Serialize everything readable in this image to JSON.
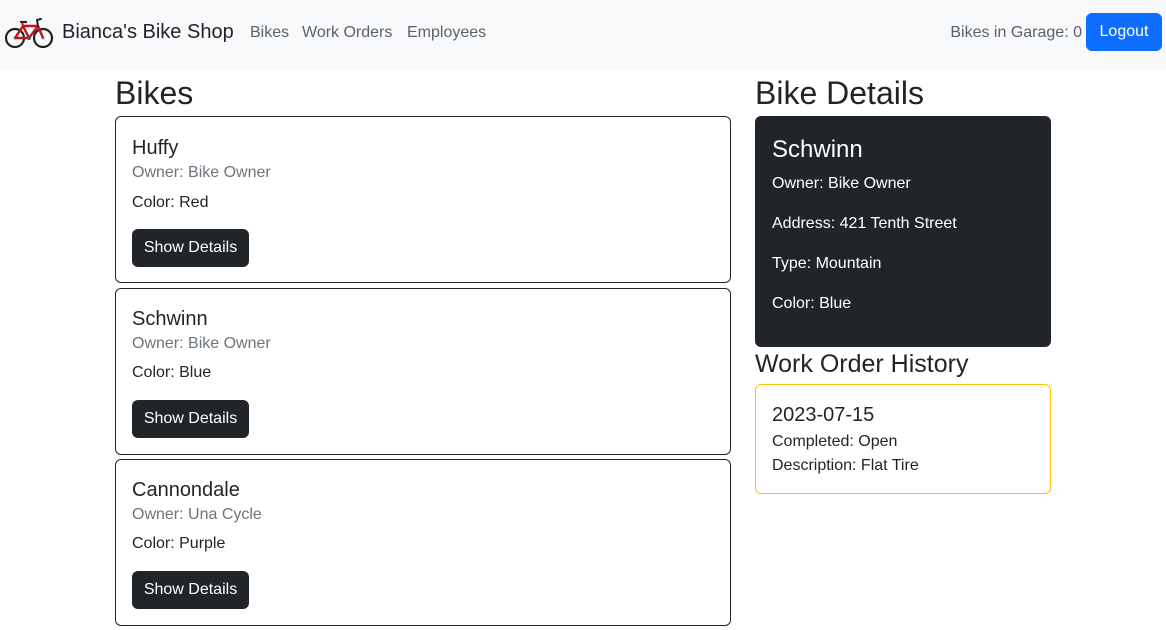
{
  "navbar": {
    "brand": "Bianca's Bike Shop",
    "links": [
      "Bikes",
      "Work Orders",
      "Employees"
    ],
    "garage_label": "Bikes in Garage:",
    "garage_count": "0",
    "logout_label": "Logout"
  },
  "bikes_section": {
    "title": "Bikes",
    "items": [
      {
        "name": "Huffy",
        "owner": "Owner: Bike Owner",
        "color": "Color: Red",
        "button": "Show Details"
      },
      {
        "name": "Schwinn",
        "owner": "Owner: Bike Owner",
        "color": "Color: Blue",
        "button": "Show Details"
      },
      {
        "name": "Cannondale",
        "owner": "Owner: Una Cycle",
        "color": "Color: Purple",
        "button": "Show Details"
      }
    ]
  },
  "details_section": {
    "title": "Bike Details",
    "name": "Schwinn",
    "owner": "Owner: Bike Owner",
    "address": "Address: 421 Tenth Street",
    "type": "Type: Mountain",
    "color": "Color: Blue"
  },
  "work_orders": {
    "title": "Work Order History",
    "items": [
      {
        "date": "2023-07-15",
        "completed": "Completed: Open",
        "description": "Description: Flat Tire"
      }
    ]
  },
  "colors": {
    "accent": "#0d6efd",
    "dark": "#212529",
    "warning": "#ffc107",
    "navbar_bg": "#f8f9fa"
  },
  "icons": {
    "brand_logo": "bicycle-icon"
  }
}
